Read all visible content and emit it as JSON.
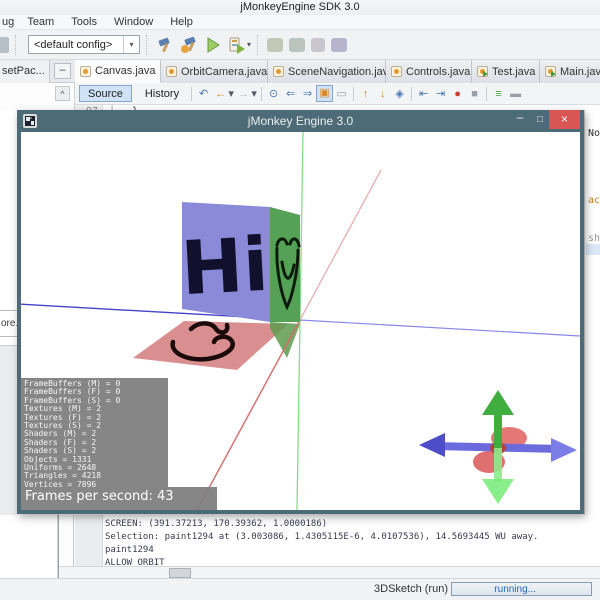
{
  "app": {
    "title": "jMonkeyEngine SDK 3.0"
  },
  "menu_bar": {
    "items": [
      "ug",
      "Team",
      "Tools",
      "Window",
      "Help"
    ]
  },
  "toolbar": {
    "config_dropdown": "<default config>",
    "dropdown_caret": "▾",
    "run_caret": "▾"
  },
  "left_panel": {
    "tab_label": "setPac...",
    "minimize_glyph": "–",
    "scroll_up_glyph": "^",
    "text_fragment": "ore."
  },
  "editor_tabs": {
    "items": [
      {
        "label": "Canvas.java",
        "close": "×"
      },
      {
        "label": "OrbitCamera.java",
        "close": "×"
      },
      {
        "label": "SceneNavigation.java",
        "close": "×"
      },
      {
        "label": "Controls.java",
        "close": "×"
      },
      {
        "label": "Test.java",
        "close": "×"
      },
      {
        "label": "Main.java",
        "close": "×"
      }
    ]
  },
  "editor": {
    "source_button": "Source",
    "history_button": "History",
    "gutter_line": "97",
    "fold_mark": "└",
    "code_line": "}",
    "right_fragments": {
      "f1": "No",
      "f2": "ac",
      "f3": "sh"
    }
  },
  "editor_toolbar": {
    "icons": [
      {
        "name": "last-edit-icon",
        "glyph": "↶"
      },
      {
        "name": "back-icon",
        "glyph": "←"
      },
      {
        "name": "back-caret-icon",
        "glyph": "▾"
      },
      {
        "name": "forward-icon",
        "glyph": "→"
      },
      {
        "name": "forward-caret-icon",
        "glyph": "▾"
      },
      {
        "name": "find-selection-icon",
        "glyph": "⊙"
      },
      {
        "name": "find-previous-icon",
        "glyph": "⇐"
      },
      {
        "name": "find-next-icon",
        "glyph": "⇒"
      },
      {
        "name": "toggle-highlight-icon",
        "glyph": "▣"
      },
      {
        "name": "rectangular-selection-icon",
        "glyph": "▭"
      },
      {
        "name": "previous-bookmark-icon",
        "glyph": "↑"
      },
      {
        "name": "next-bookmark-icon",
        "glyph": "↓"
      },
      {
        "name": "toggle-bookmark-icon",
        "glyph": "◈"
      },
      {
        "name": "shift-left-icon",
        "glyph": "⇤"
      },
      {
        "name": "shift-right-icon",
        "glyph": "⇥"
      },
      {
        "name": "record-macro-icon",
        "glyph": "●"
      },
      {
        "name": "stop-macro-icon",
        "glyph": "■"
      },
      {
        "name": "comment-icon",
        "glyph": "≡"
      },
      {
        "name": "uncomment-icon",
        "glyph": "▬"
      }
    ]
  },
  "jme_window": {
    "title": "jMonkey Engine 3.0",
    "minimize_glyph": "–",
    "maximize_glyph": "□",
    "close_glyph": "×",
    "scene": {
      "cube_text": "Hi"
    },
    "stats_lines": "FrameBuffers (M) = 0\nFrameBuffers (F) = 0\nFrameBuffers (S) = 0\nTextures (M) = 2\nTextures (F) = 2\nTextures (S) = 2\nShaders (M) = 2\nShaders (F) = 2\nShaders (S) = 2\nObjects = 1331\nUniforms = 2648\nTriangles = 4218\nVertices = 7896",
    "fps": "Frames per second: 43"
  },
  "output": {
    "lines": [
      "SCREEN: (391.37213, 170.39362, 1.0000186)",
      "Selection: paint1294 at (3.003086, 1.4305115E-6, 4.0107536), 14.5693445 WU away.",
      "paint1294",
      "ALLOW ORBIT"
    ]
  },
  "status_bar": {
    "task": "3DSketch (run)",
    "progress": "running..."
  },
  "colors": {
    "jme_titlebar": "#4d6a77",
    "close_button": "#d85654",
    "cube_blue": "#8a8ad9",
    "cube_green": "#55a257",
    "floor_red": "#d98f8f",
    "axis_green": "#86dc86",
    "axis_blue": "#4343cc",
    "axis_red": "#d96b6b",
    "stats_bg": "#808080"
  }
}
